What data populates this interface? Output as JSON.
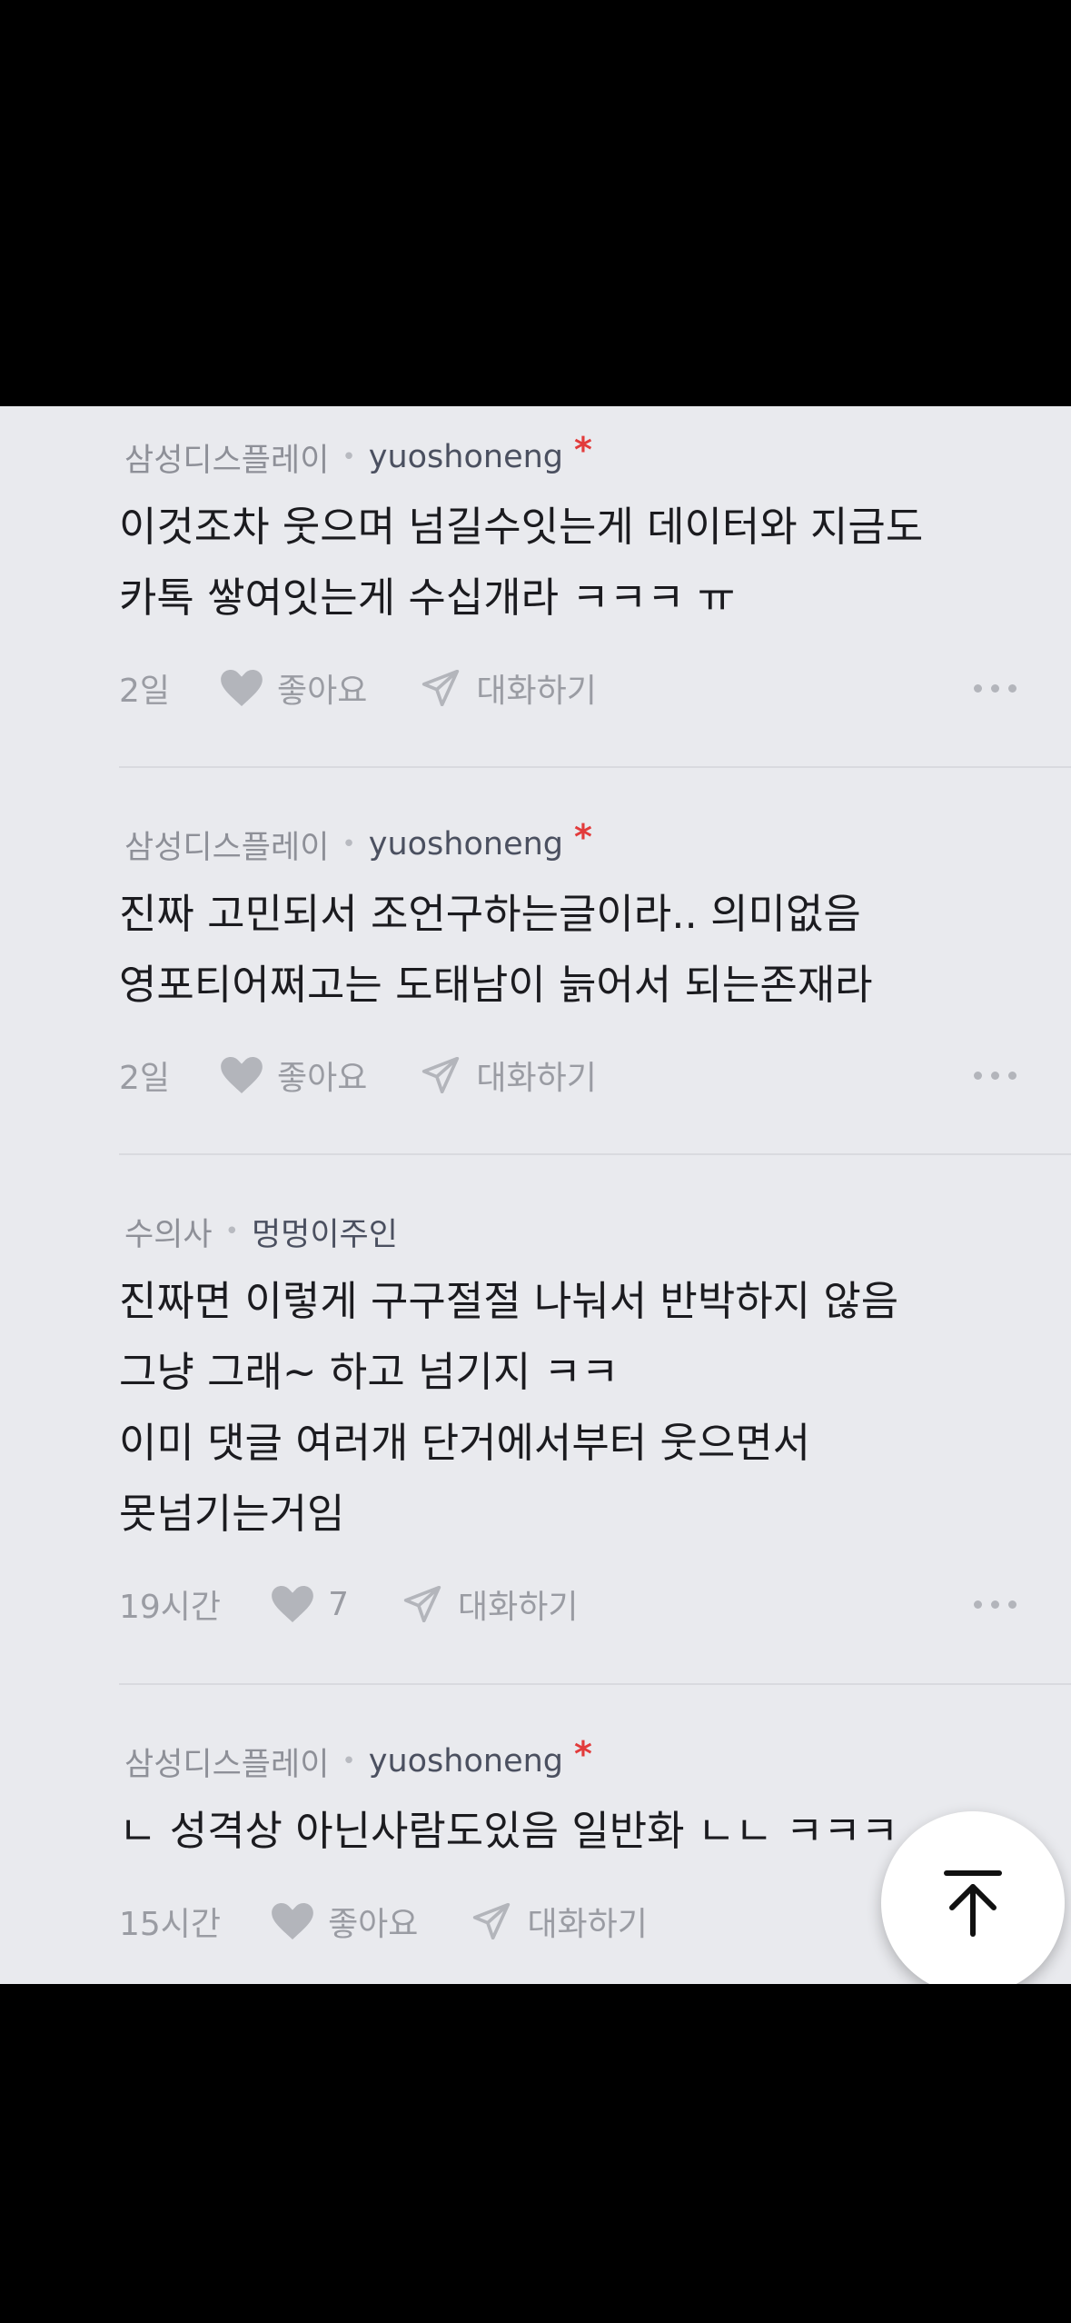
{
  "comments": [
    {
      "company": "삼성디스플레이",
      "nickname": "yuoshoneng",
      "author_mark": "*",
      "lines": [
        "이것조차 웃으며 넘길수잇는게 데이터와 지금도",
        "카톡 쌓여잇는게 수십개라 ㅋㅋㅋ ㅠ"
      ],
      "time": "2일",
      "like_label": "좋아요",
      "reply_label": "대화하기"
    },
    {
      "company": "삼성디스플레이",
      "nickname": "yuoshoneng",
      "author_mark": "*",
      "lines": [
        "진짜 고민되서 조언구하는글이라.. 의미없음",
        "영포티어쩌고는 도태남이 늙어서 되는존재라"
      ],
      "time": "2일",
      "like_label": "좋아요",
      "reply_label": "대화하기"
    },
    {
      "company": "수의사",
      "nickname": "멍멍이주인",
      "author_mark": "",
      "lines": [
        "진짜면 이렇게 구구절절 나눠서 반박하지 않음",
        "그냥 그래~ 하고 넘기지 ㅋㅋ",
        "이미 댓글 여러개 단거에서부터 웃으면서",
        "못넘기는거임"
      ],
      "time": "19시간",
      "like_label": "7",
      "reply_label": "대화하기"
    },
    {
      "company": "삼성디스플레이",
      "nickname": "yuoshoneng",
      "author_mark": "*",
      "lines": [
        "ㄴ 성격상 아닌사람도있음 일반화 ㄴㄴ ㅋㅋㅋ"
      ],
      "time": "15시간",
      "like_label": "좋아요",
      "reply_label": "대화하기"
    }
  ],
  "icons": {
    "like": "heart-icon",
    "reply": "paper-plane-icon",
    "more": "more-dots-icon",
    "fab": "arrow-up-to-top-icon"
  },
  "colors": {
    "background": "#e9eaee",
    "author_mark": "#e23b3b",
    "meta_text": "#9a9ca3",
    "body_text": "#1b1b1f"
  }
}
